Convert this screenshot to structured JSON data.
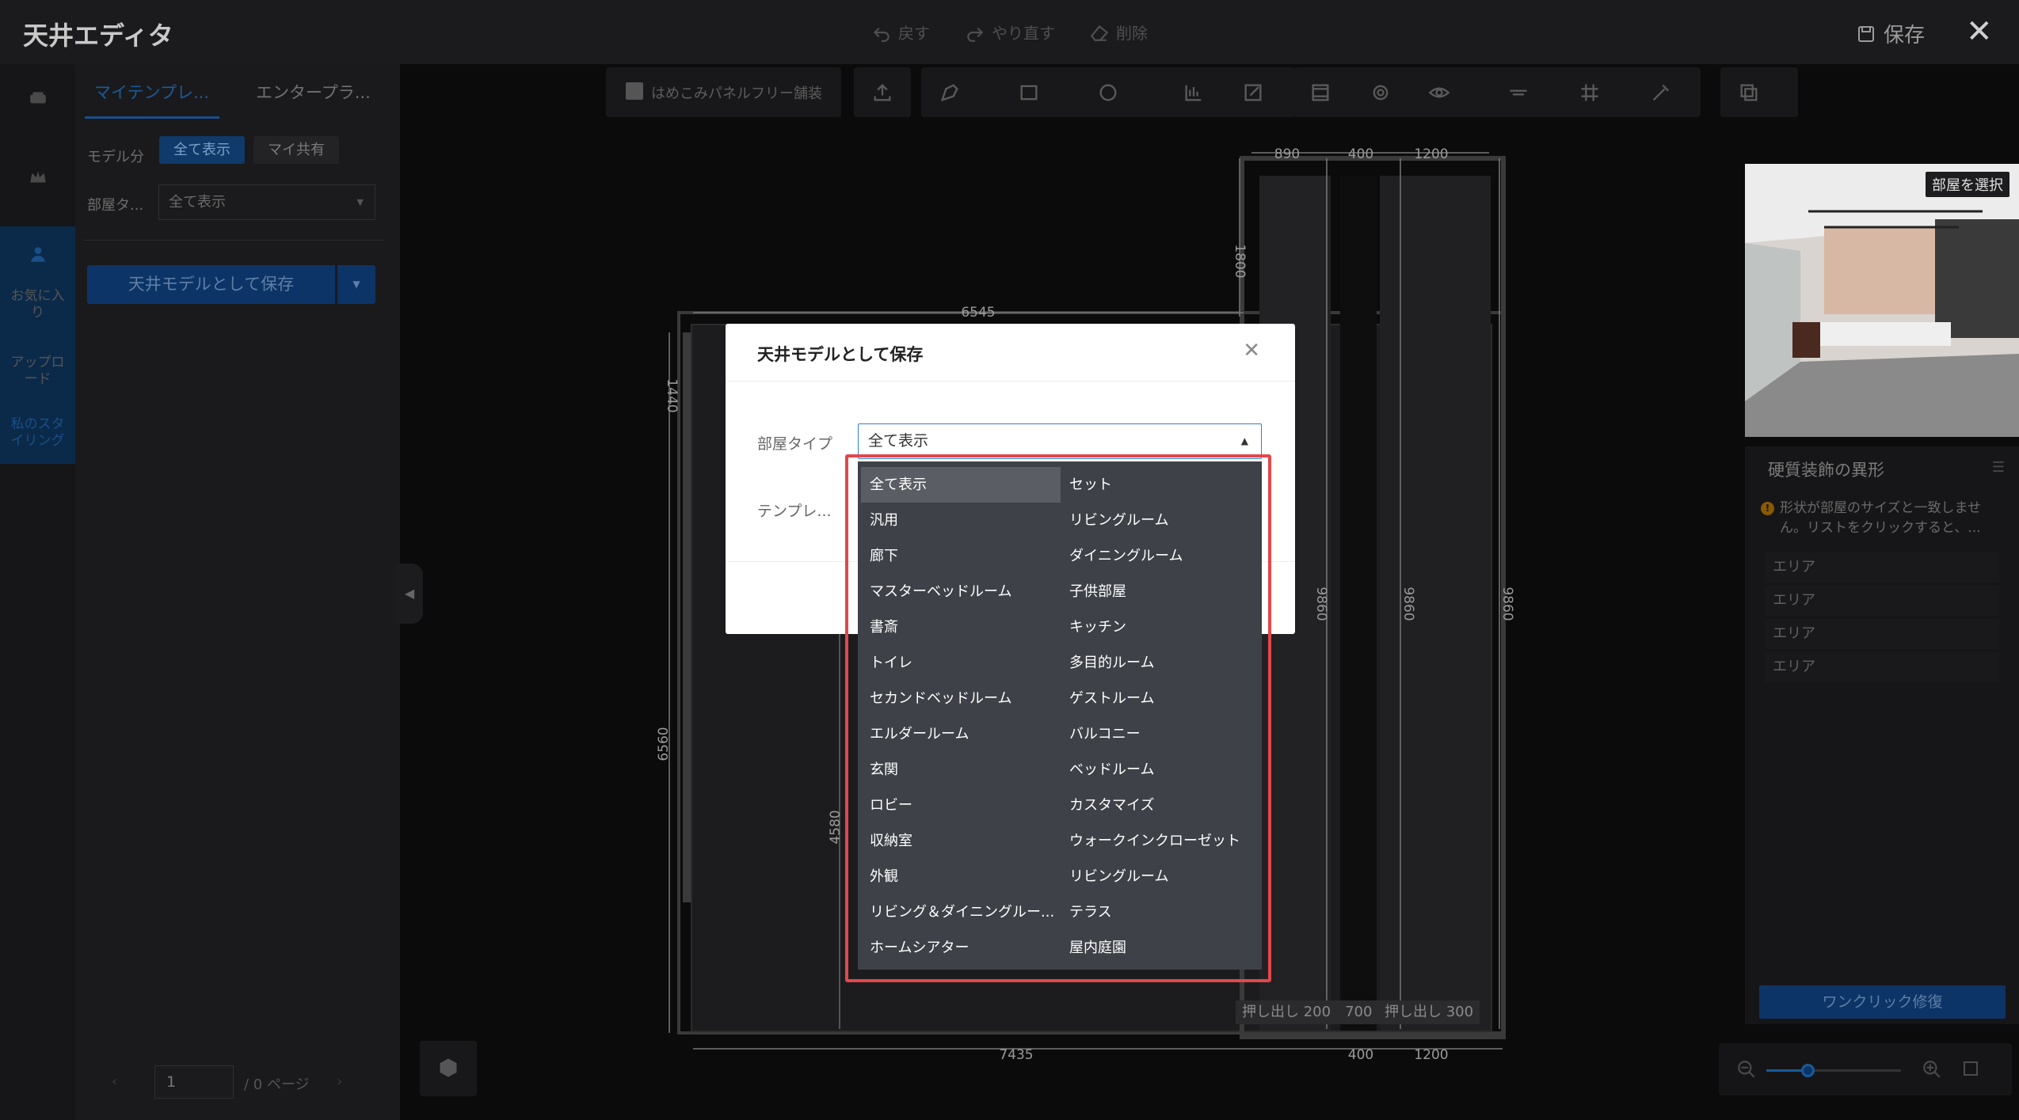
{
  "app": {
    "title": "天井エディタ"
  },
  "topbar": {
    "undo_label": "戻す",
    "redo_label": "やり直す",
    "delete_label": "削除",
    "save_label": "保存"
  },
  "rail": {
    "favorites_label": "お気に入り",
    "upload_label": "アップロード",
    "my_styling_label": "私のスタイリング"
  },
  "panel": {
    "tabs": [
      "マイテンプレ...",
      "エンタープラ..."
    ],
    "model_filter_label": "モデル分",
    "model_filter_options": [
      "全て表示",
      "マイ共有"
    ],
    "room_type_label": "部屋タ...",
    "room_type_value": "全て表示",
    "save_button_label": "天井モデルとして保存",
    "pager": {
      "page": "1",
      "total_label": "/ 0 ページ"
    }
  },
  "toolbar": {
    "checkbox_label": "はめこみパネルフリー舗装"
  },
  "floor_plan": {
    "dimensions": [
      "890",
      "400",
      "1200",
      "6545",
      "1800",
      "1440",
      "9860",
      "9860",
      "9860",
      "6560",
      "4580",
      "7435",
      "400",
      "1200"
    ],
    "push_labels": [
      "押し出し 200　700",
      "押し出し 300"
    ]
  },
  "right_panel": {
    "select_room_label": "部屋を選択",
    "title": "硬質装飾の異形",
    "warning": "形状が部屋のサイズと一致しません。リストをクリックすると、...",
    "areas": [
      "エリア",
      "エリア",
      "エリア",
      "エリア"
    ],
    "fix_button_label": "ワンクリック修復"
  },
  "modal": {
    "title": "天井モデルとして保存",
    "room_type_label": "部屋タイプ",
    "room_type_value": "全て表示",
    "template_label": "テンプレ..."
  },
  "dropdown": {
    "selected": "全て表示",
    "left_column": [
      "全て表示",
      "汎用",
      "廊下",
      "マスターベッドルーム",
      "書斎",
      "トイレ",
      "セカンドベッドルーム",
      "エルダールーム",
      "玄関",
      "ロビー",
      "収納室",
      "外観",
      "リビング＆ダイニングルー...",
      "ホームシアター"
    ],
    "right_column": [
      "セット",
      "リビングルーム",
      "ダイニングルーム",
      "子供部屋",
      "キッチン",
      "多目的ルーム",
      "ゲストルーム",
      "バルコニー",
      "ベッドルーム",
      "カスタマイズ",
      "ウォークインクローゼット",
      "リビングルーム",
      "テラス",
      "屋内庭園"
    ]
  },
  "colors": {
    "accent": "#2f7fd4",
    "highlight": "#e2474c",
    "dropdown_bg": "#3e4147"
  }
}
